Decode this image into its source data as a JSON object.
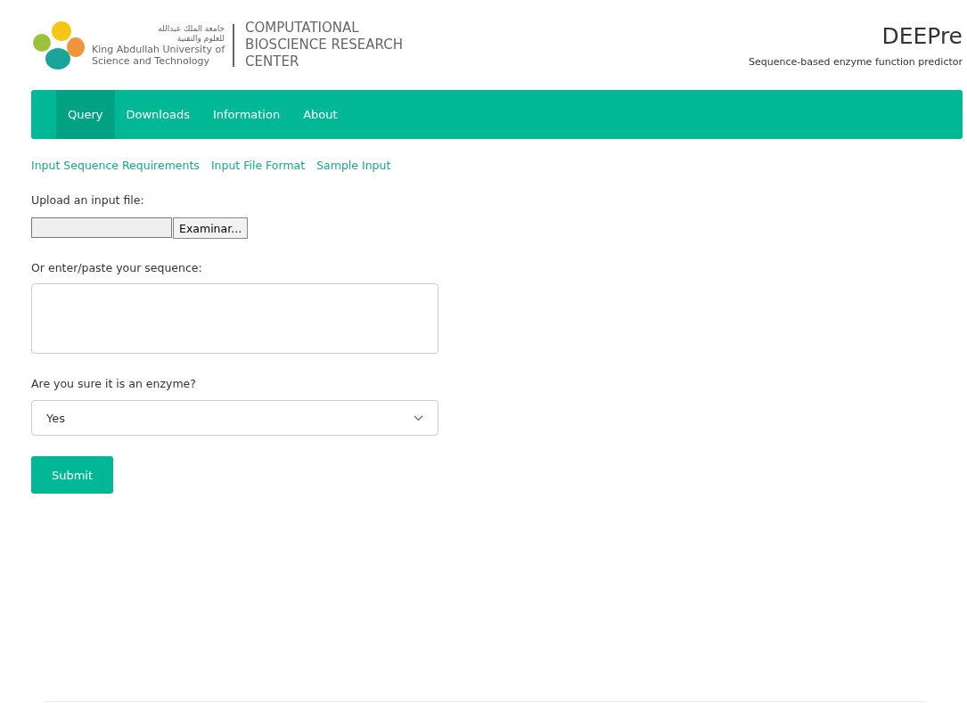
{
  "header": {
    "university_arabic_line_1": "جامعة الملك عبدالله",
    "university_arabic_line_2": "للعلوم والتقنية",
    "university_name_line_1": "King Abdullah University of",
    "university_name_line_2": "Science and Technology",
    "center_name_lines": [
      "COMPUTATIONAL",
      "BIOSCIENCE RESEARCH",
      "CENTER"
    ],
    "app_title": "DEEPre",
    "app_subtitle": "Sequence-based enzyme function predictor"
  },
  "nav": [
    {
      "label": "Query",
      "selected": true
    },
    {
      "label": "Downloads",
      "selected": false
    },
    {
      "label": "Information",
      "selected": false
    },
    {
      "label": "About",
      "selected": false
    }
  ],
  "help_links": [
    "Input Sequence Requirements",
    "Input File Format",
    "Sample Input"
  ],
  "form": {
    "upload_label": "Upload an input file:",
    "browse_button": "Examinar...",
    "sequence_label": "Or enter/paste your sequence:",
    "enzyme_label": "Are you sure it is an enzyme?",
    "enzyme_value": "Yes",
    "submit_button": "Submit"
  }
}
